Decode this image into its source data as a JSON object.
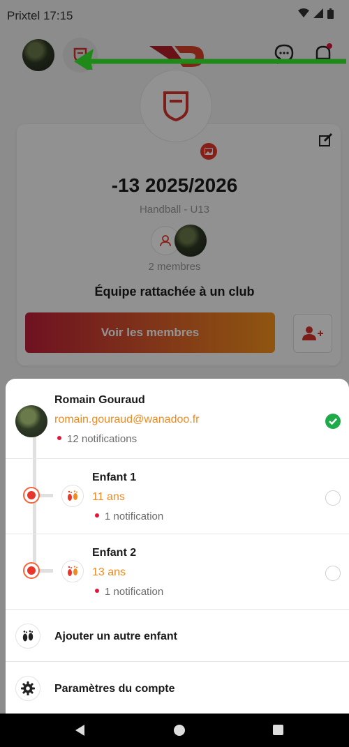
{
  "status_bar": {
    "carrier_time": "Prixtel 17:15"
  },
  "team": {
    "name": "-13 2025/2026",
    "subtitle": "Handball - U13",
    "members_count": "2 membres",
    "affiliation": "Équipe rattachée à un club",
    "view_members_label": "Voir les membres"
  },
  "account_sheet": {
    "parent": {
      "name": "Romain Gouraud",
      "email": "romain.gouraud@wanadoo.fr",
      "notifications": "12 notifications",
      "selected": true
    },
    "children": [
      {
        "name": "Enfant 1",
        "age": "11 ans",
        "notifications": "1 notification",
        "selected": false
      },
      {
        "name": "Enfant 2",
        "age": "13 ans",
        "notifications": "1 notification",
        "selected": false
      }
    ],
    "actions": {
      "add_child": "Ajouter un autre enfant",
      "settings": "Paramètres du compte"
    }
  },
  "colors": {
    "accent_orange": "#f08a1f",
    "brand_red": "#e8362b",
    "success_green": "#1faa4a",
    "notification_dot": "#e0163b"
  },
  "icons": [
    "team-shield-icon",
    "chat-icon",
    "notification-bell-icon",
    "edit-icon",
    "image-icon",
    "user-icon",
    "add-user-icon",
    "baby-feet-icon",
    "gear-icon",
    "check-icon"
  ]
}
